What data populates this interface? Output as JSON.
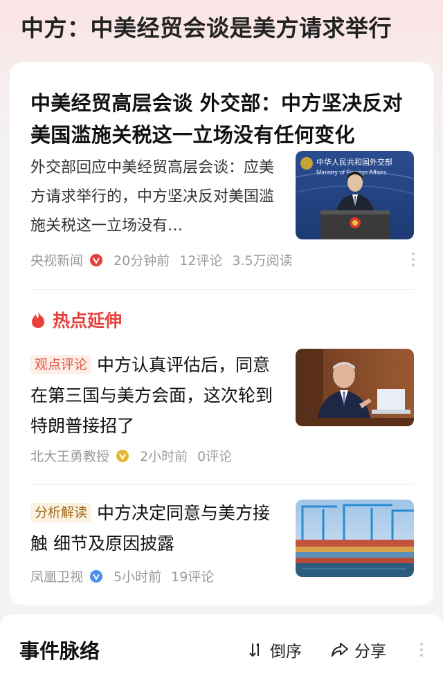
{
  "topic": {
    "title": "中方：中美经贸会谈是美方请求举行"
  },
  "main_article": {
    "headline": "中美经贸高层会谈 外交部：中方坚决反对美国滥施关税这一立场没有任何变化",
    "summary": "外交部回应中美经贸高层会谈：应美方请求举行的，中方坚决反对美国滥施关税这一立场没有…",
    "thumb_banner_text": "中华人民共和国外交部",
    "thumb_banner_en": "Ministry of Foreign Affairs",
    "source": "央视新闻",
    "time": "20分钟前",
    "comments": "12评论",
    "reads": "3.5万阅读"
  },
  "hot_extension": {
    "title": "热点延伸"
  },
  "related": [
    {
      "tag": "观点评论",
      "title": "中方认真评估后，同意在第三国与美方会面，这次轮到特朗普接招了",
      "source": "北大王勇教授",
      "time": "2小时前",
      "comments": "0评论"
    },
    {
      "tag": "分析解读",
      "title": "中方决定同意与美方接触 细节及原因披露",
      "source": "凤凰卫视",
      "time": "5小时前",
      "comments": "19评论"
    }
  ],
  "events": {
    "title": "事件脉络",
    "sort_label": "倒序",
    "share_label": "分享"
  },
  "colors": {
    "accent_red": "#e8413c",
    "badge_red": "#e2403a",
    "badge_gold": "#e9b634",
    "badge_blue": "#4b8ee8",
    "meta_gray": "#9a9a9a"
  },
  "icons": [
    "verified-red-icon",
    "verified-gold-icon",
    "verified-blue-icon",
    "flame-icon",
    "more-icon",
    "sort-icon",
    "share-icon"
  ]
}
